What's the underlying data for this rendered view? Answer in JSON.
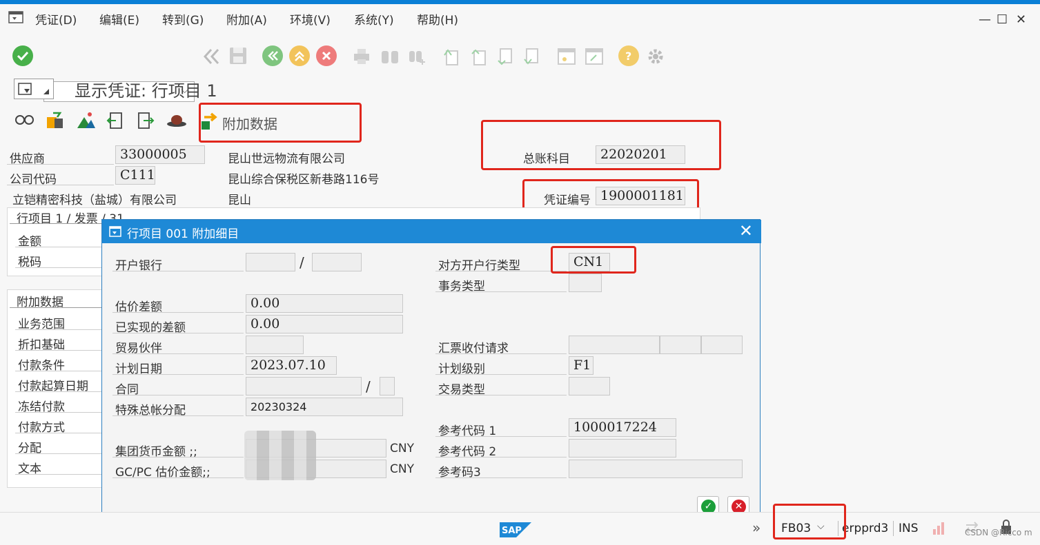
{
  "menu": [
    "凭证(D)",
    "编辑(E)",
    "转到(G)",
    "附加(A)",
    "环境(V)",
    "系统(Y)",
    "帮助(H)"
  ],
  "window_controls": [
    "—",
    "☐",
    "✕"
  ],
  "title": "显示凭证: 行项目 1",
  "app_toolbar": {
    "additional_data_label": "附加数据"
  },
  "header": {
    "vendor_label": "供应商",
    "vendor_value": "33000005",
    "vendor_name": "昆山世远物流有限公司",
    "company_code_label": "公司代码",
    "company_code_value": "C111",
    "vendor_address": "昆山综合保税区新巷路116号",
    "company_name": "立铠精密科技（盐城）有限公司",
    "vendor_city": "昆山",
    "gl_account_label": "总账科目",
    "gl_account_value": "22020201",
    "doc_no_label": "凭证编号",
    "doc_no_value": "1900001181"
  },
  "left_panel": {
    "line_item_tab": "行项目 1 / 发票 / 31",
    "amount_label": "金额",
    "tax_code_label": "税码",
    "additional_data_tab": "附加数据",
    "fields": [
      "业务范围",
      "折扣基础",
      "付款条件",
      "付款起算日期",
      "冻结付款",
      "付款方式",
      "分配",
      "文本"
    ]
  },
  "dialog": {
    "title": "行项目 001 附加细目",
    "bank_label": "开户银行",
    "separator": "/",
    "partner_bank_type_label": "对方开户行类型",
    "partner_bank_type_value": "CN1",
    "transaction_type_label": "事务类型",
    "valuation_diff_label": "估价差额",
    "valuation_diff_value": "0.00",
    "realized_diff_label": "已实现的差额",
    "realized_diff_value": "0.00",
    "trading_partner_label": "贸易伙伴",
    "bill_of_exchange_label": "汇票收付请求",
    "planning_date_label": "计划日期",
    "planning_date_value": "2023.07.10",
    "planning_level_label": "计划级别",
    "planning_level_value": "F1",
    "contract_label": "合同",
    "flow_type_label": "交易类型",
    "special_gl_assign_label": "特殊总帐分配",
    "special_gl_assign_value": "20230324",
    "ref_key1_label": "参考代码 1",
    "ref_key1_value": "1000017224",
    "ref_key2_label": "参考代码 2",
    "ref_key3_label": "参考码3",
    "group_currency_label": "集团货币金额   ;;",
    "gc_pc_label": "GC/PC 估价金额;;",
    "currency1": "CNY",
    "currency2": "CNY"
  },
  "status": {
    "tcode": "FB03",
    "system": "erpprd3",
    "mode": "INS",
    "watermark": "CSDN @Ricco m"
  },
  "colors": {
    "accent": "#1e89d6",
    "highlight": "#e0261c",
    "ok": "#1c9f3a",
    "cancel": "#d8202a"
  }
}
